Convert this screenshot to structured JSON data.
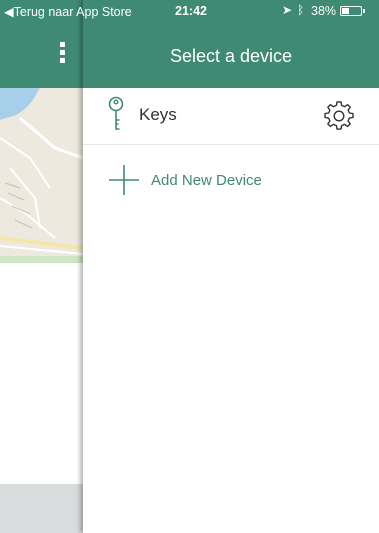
{
  "status_bar": {
    "back_label": "◀Terug naar App Store",
    "time": "21:42",
    "location_icon": "location-arrow-icon",
    "bluetooth_icon": "bluetooth-icon",
    "battery_percent": "38%",
    "battery_level": 0.38
  },
  "background_app": {
    "menu_icon": "kebab-menu-icon"
  },
  "panel": {
    "title": "Select a device",
    "devices": [
      {
        "name": "Keys",
        "icon": "key-icon",
        "settings_icon": "gear-icon"
      }
    ],
    "add_device_label": "Add New Device",
    "add_icon": "plus-icon"
  },
  "colors": {
    "header_green": "#3f8a73",
    "accent_green": "#3f8a73"
  }
}
